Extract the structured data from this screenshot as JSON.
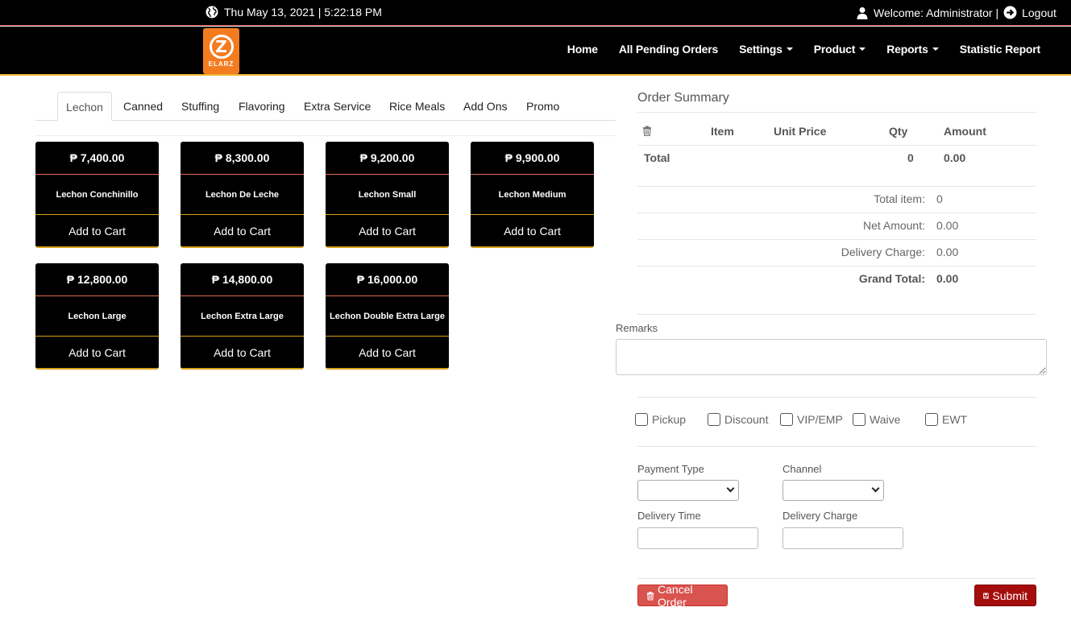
{
  "topbar": {
    "datetime": "Thu May 13, 2021 | 5:22:18 PM",
    "welcome": "Welcome: Administrator |",
    "logout": "Logout"
  },
  "logo": {
    "mark": "Z",
    "text": "ELARZ"
  },
  "nav": {
    "home": "Home",
    "pending": "All Pending Orders",
    "settings": "Settings",
    "product": "Product",
    "reports": "Reports",
    "statistic": "Statistic Report"
  },
  "tabs": [
    "Lechon",
    "Canned",
    "Stuffing",
    "Flavoring",
    "Extra Service",
    "Rice Meals",
    "Add Ons",
    "Promo"
  ],
  "products": [
    {
      "price": "₱ 7,400.00",
      "name": "Lechon Conchinillo",
      "cart": "Add to Cart"
    },
    {
      "price": "₱ 8,300.00",
      "name": "Lechon De Leche",
      "cart": "Add to Cart"
    },
    {
      "price": "₱ 9,200.00",
      "name": "Lechon Small",
      "cart": "Add to Cart"
    },
    {
      "price": "₱ 9,900.00",
      "name": "Lechon Medium",
      "cart": "Add to Cart"
    },
    {
      "price": "₱ 12,800.00",
      "name": "Lechon Large",
      "cart": "Add to Cart"
    },
    {
      "price": "₱ 14,800.00",
      "name": "Lechon Extra Large",
      "cart": "Add to Cart"
    },
    {
      "price": "₱ 16,000.00",
      "name": "Lechon Double Extra Large",
      "cart": "Add to Cart"
    }
  ],
  "summary": {
    "title": "Order Summary",
    "headers": {
      "item": "Item",
      "unit_price": "Unit Price",
      "qty": "Qty",
      "amount": "Amount"
    },
    "total_label": "Total",
    "total_qty": "0",
    "total_amount": "0.00",
    "total_item_label": "Total item:",
    "total_item": "0",
    "net_label": "Net Amount:",
    "net": "0.00",
    "delivery_label": "Delivery Charge:",
    "delivery": "0.00",
    "grand_label": "Grand Total:",
    "grand": "0.00"
  },
  "remarks": {
    "label": "Remarks",
    "value": ""
  },
  "options": [
    "Pickup",
    "Discount",
    "VIP/EMP",
    "Waive",
    "EWT"
  ],
  "form": {
    "payment_type_label": "Payment Type",
    "channel_label": "Channel",
    "delivery_time_label": "Delivery Time",
    "delivery_charge_label": "Delivery Charge"
  },
  "buttons": {
    "cancel": "Cancel Order",
    "submit": "Submit"
  },
  "colors": {
    "cancel": "#d9534f",
    "submit": "#a50d0d",
    "accent": "#f0b431",
    "logo": "#f47c20"
  }
}
